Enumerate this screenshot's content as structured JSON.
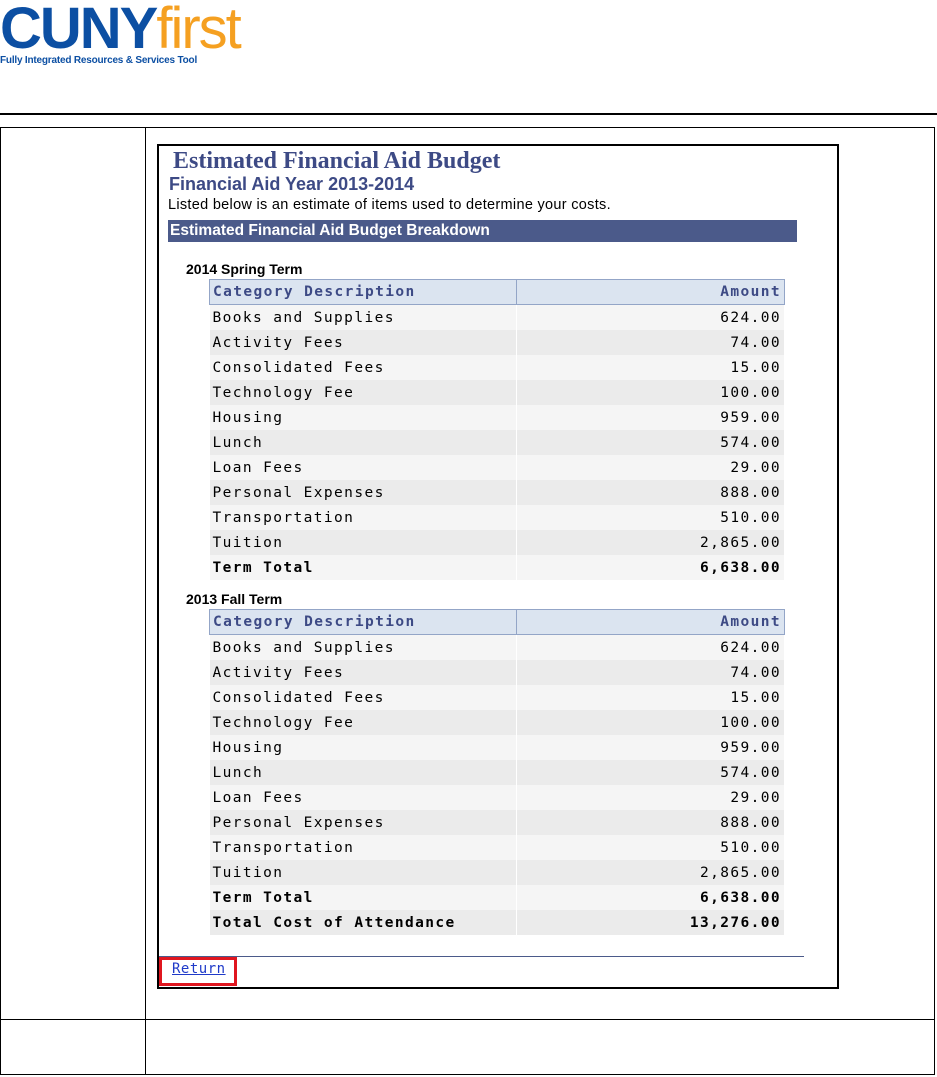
{
  "logo": {
    "brand_part1": "CUNY",
    "brand_part2": "first",
    "tagline": "Fully Integrated Resources & Services Tool"
  },
  "page": {
    "title": "Estimated Financial Aid Budget",
    "subtitle": "Financial Aid Year 2013-2014",
    "intro": "Listed below is an estimate of  items used to determine your costs.",
    "section_header": "Estimated Financial Aid Budget Breakdown"
  },
  "terms": [
    {
      "name": "2014 Spring Term",
      "columns": {
        "desc": "Category Description",
        "amount": "Amount"
      },
      "rows": [
        {
          "desc": "Books and Supplies",
          "amount": "624.00"
        },
        {
          "desc": "Activity Fees",
          "amount": "74.00"
        },
        {
          "desc": "Consolidated Fees",
          "amount": "15.00"
        },
        {
          "desc": "Technology Fee",
          "amount": "100.00"
        },
        {
          "desc": "Housing",
          "amount": "959.00"
        },
        {
          "desc": "Lunch",
          "amount": "574.00"
        },
        {
          "desc": "Loan Fees",
          "amount": "29.00"
        },
        {
          "desc": "Personal Expenses",
          "amount": "888.00"
        },
        {
          "desc": "Transportation",
          "amount": "510.00"
        },
        {
          "desc": "Tuition",
          "amount": "2,865.00"
        }
      ],
      "total": {
        "desc": "Term Total",
        "amount": "6,638.00"
      }
    },
    {
      "name": "2013 Fall Term",
      "columns": {
        "desc": "Category Description",
        "amount": "Amount"
      },
      "rows": [
        {
          "desc": "Books and Supplies",
          "amount": "624.00"
        },
        {
          "desc": "Activity Fees",
          "amount": "74.00"
        },
        {
          "desc": "Consolidated Fees",
          "amount": "15.00"
        },
        {
          "desc": "Technology Fee",
          "amount": "100.00"
        },
        {
          "desc": "Housing",
          "amount": "959.00"
        },
        {
          "desc": "Lunch",
          "amount": "574.00"
        },
        {
          "desc": "Loan Fees",
          "amount": "29.00"
        },
        {
          "desc": "Personal Expenses",
          "amount": "888.00"
        },
        {
          "desc": "Transportation",
          "amount": "510.00"
        },
        {
          "desc": "Tuition",
          "amount": "2,865.00"
        }
      ],
      "total": {
        "desc": "Term Total",
        "amount": "6,638.00"
      },
      "grand_total": {
        "desc": "Total Cost of Attendance",
        "amount": "13,276.00"
      }
    }
  ],
  "footer": {
    "return_label": "Return"
  },
  "colors": {
    "brand_blue": "#0c4fa3",
    "brand_orange": "#f5a021",
    "header_bar": "#4b5a8a",
    "highlight": "#e0161f"
  }
}
